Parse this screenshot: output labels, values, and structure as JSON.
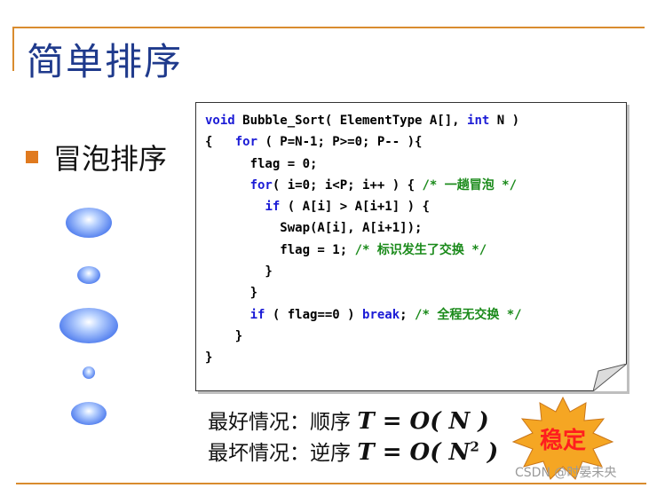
{
  "slide": {
    "title": "简单排序",
    "bullet": "冒泡排序"
  },
  "code": {
    "lines": [
      [
        {
          "t": "void",
          "c": "kw"
        },
        {
          "t": " Bubble_Sort( ElementType A[], "
        },
        {
          "t": "int",
          "c": "kw"
        },
        {
          "t": " N )"
        }
      ],
      [
        {
          "t": "{   "
        },
        {
          "t": "for",
          "c": "kw"
        },
        {
          "t": " ( P=N-1; P>=0; P-- ){"
        }
      ],
      [
        {
          "t": "      flag = 0;"
        }
      ],
      [
        {
          "t": "      "
        },
        {
          "t": "for",
          "c": "kw"
        },
        {
          "t": "( i=0; i<P; i++ ) { "
        },
        {
          "t": "/* 一趟冒泡 */",
          "c": "cm"
        }
      ],
      [
        {
          "t": "        "
        },
        {
          "t": "if",
          "c": "kw"
        },
        {
          "t": " ( A[i] > A[i+1] ) {"
        }
      ],
      [
        {
          "t": "          Swap(A[i], A[i+1]);"
        }
      ],
      [
        {
          "t": "          flag = 1; "
        },
        {
          "t": "/* 标识发生了交换 */",
          "c": "cm"
        }
      ],
      [
        {
          "t": "        }"
        }
      ],
      [
        {
          "t": "      }"
        }
      ],
      [
        {
          "t": "      "
        },
        {
          "t": "if",
          "c": "kw"
        },
        {
          "t": " ( flag==0 ) "
        },
        {
          "t": "break",
          "c": "kw"
        },
        {
          "t": "; "
        },
        {
          "t": "/* 全程无交换 */",
          "c": "cm"
        }
      ],
      [
        {
          "t": "    }"
        }
      ],
      [
        {
          "t": "}"
        }
      ]
    ]
  },
  "complexity": {
    "best_label": "最好情况：顺序",
    "best_formula": "T = O( N )",
    "worst_label": "最坏情况：逆序",
    "worst_formula_base": "T = O( N",
    "worst_formula_exp": "2",
    "worst_formula_close": " )"
  },
  "badge": {
    "text": "稳定"
  },
  "watermark": "CSDN @时晏未央",
  "colors": {
    "title": "#1f3a8c",
    "rule": "#d98c2f",
    "keyword": "#1b1bd6",
    "comment": "#1a8a1a",
    "badge_fill": "#f5a623",
    "badge_text": "#ff1e1e"
  }
}
